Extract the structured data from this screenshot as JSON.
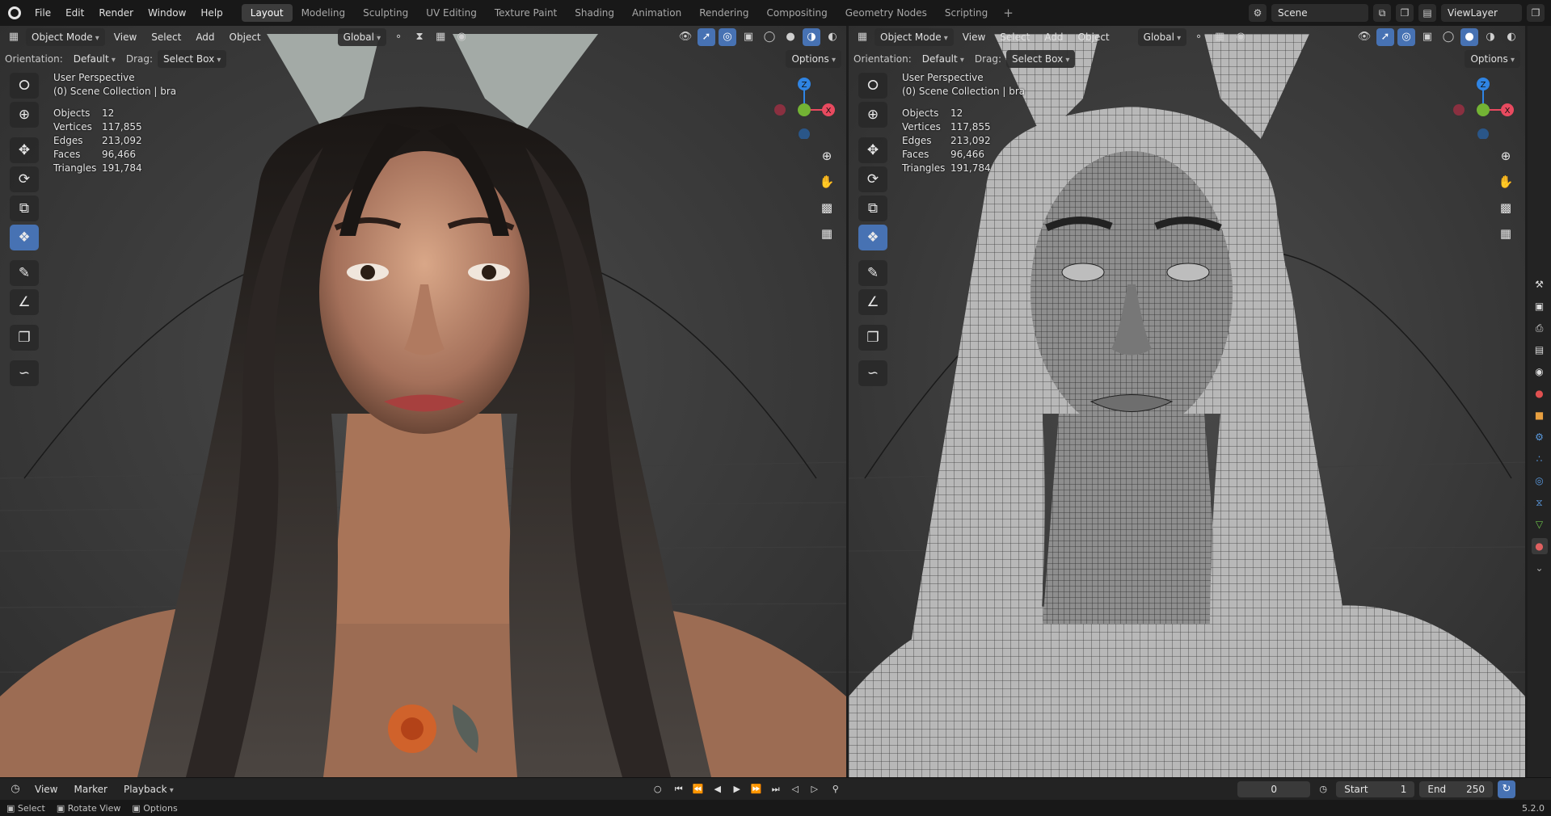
{
  "menubar": {
    "items": [
      "File",
      "Edit",
      "Render",
      "Window",
      "Help"
    ],
    "workspaces": [
      "Layout",
      "Modeling",
      "Sculpting",
      "UV Editing",
      "Texture Paint",
      "Shading",
      "Animation",
      "Rendering",
      "Compositing",
      "Geometry Nodes",
      "Scripting"
    ],
    "active_workspace": "Layout",
    "add_tab": "+",
    "scene": "Scene",
    "view_layer": "ViewLayer"
  },
  "viewport_header": {
    "mode": "Object Mode",
    "menu": [
      "View",
      "Select",
      "Add",
      "Object"
    ],
    "transform_orientation": "Global",
    "orientation_label": "Orientation:",
    "orientation_value": "Default",
    "drag_label": "Drag:",
    "drag_value": "Select Box",
    "options": "Options"
  },
  "viewport_overlay": {
    "perspective": "User Perspective",
    "collection": "(0) Scene Collection | bra",
    "stats": [
      {
        "label": "Objects",
        "value": "12"
      },
      {
        "label": "Vertices",
        "value": "117,855"
      },
      {
        "label": "Edges",
        "value": "213,092"
      },
      {
        "label": "Faces",
        "value": "96,466"
      },
      {
        "label": "Triangles",
        "value": "191,784"
      }
    ]
  },
  "gizmo": {
    "z": "Z",
    "x": "X"
  },
  "timeline": {
    "menu": [
      "View",
      "Marker"
    ],
    "playback": "Playback",
    "current_frame": "0",
    "start_label": "Start",
    "start": "1",
    "end_label": "End",
    "end": "250"
  },
  "statusbar": {
    "items": [
      "Select",
      "Rotate View",
      "Options"
    ],
    "version": "5.2.0"
  },
  "colors": {
    "accent": "#4772b3",
    "axis_x": "#e84a5f",
    "axis_y": "#73b334",
    "axis_z": "#2f84e3"
  }
}
